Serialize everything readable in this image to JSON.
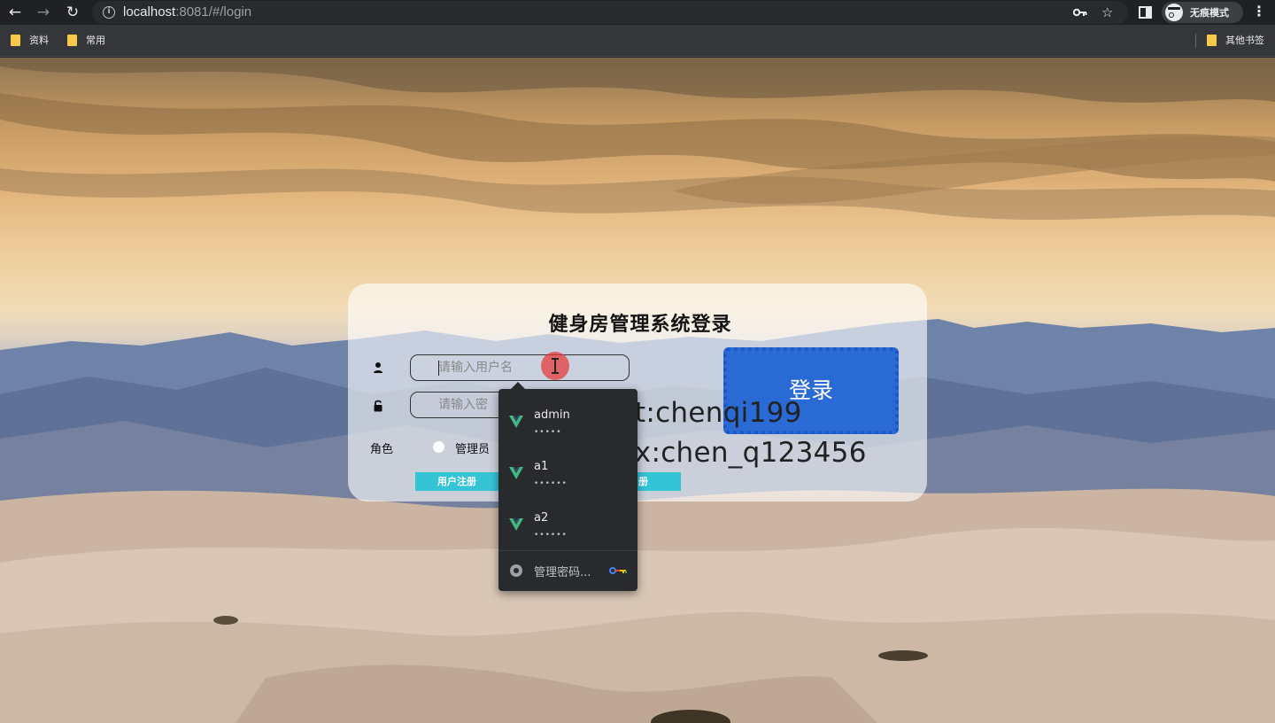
{
  "browser": {
    "url_host": "localhost",
    "url_path": ":8081/#/login",
    "incognito_label": "无痕模式",
    "bookmarks": [
      {
        "label": "资料"
      },
      {
        "label": "常用"
      }
    ],
    "other_bookmarks": "其他书签"
  },
  "login": {
    "title": "健身房管理系统登录",
    "username_placeholder": "请输入用户名",
    "password_placeholder": "请输入密",
    "role_label": "角色",
    "role_option": "管理员",
    "register_user": "用户注册",
    "register_other": "册",
    "login_button": "登录"
  },
  "overlay": {
    "git": "git:chenqi199",
    "wx": "v x:chen_q123456"
  },
  "autofill": {
    "items": [
      {
        "user": "admin",
        "dots": "•••••"
      },
      {
        "user": "a1",
        "dots": "••••••"
      },
      {
        "user": "a2",
        "dots": "••••••"
      }
    ],
    "manage_label": "管理密码..."
  },
  "colors": {
    "login_button": "#2a6ad5",
    "register_button": "#35c3d6",
    "vue_green": "#42b883"
  }
}
